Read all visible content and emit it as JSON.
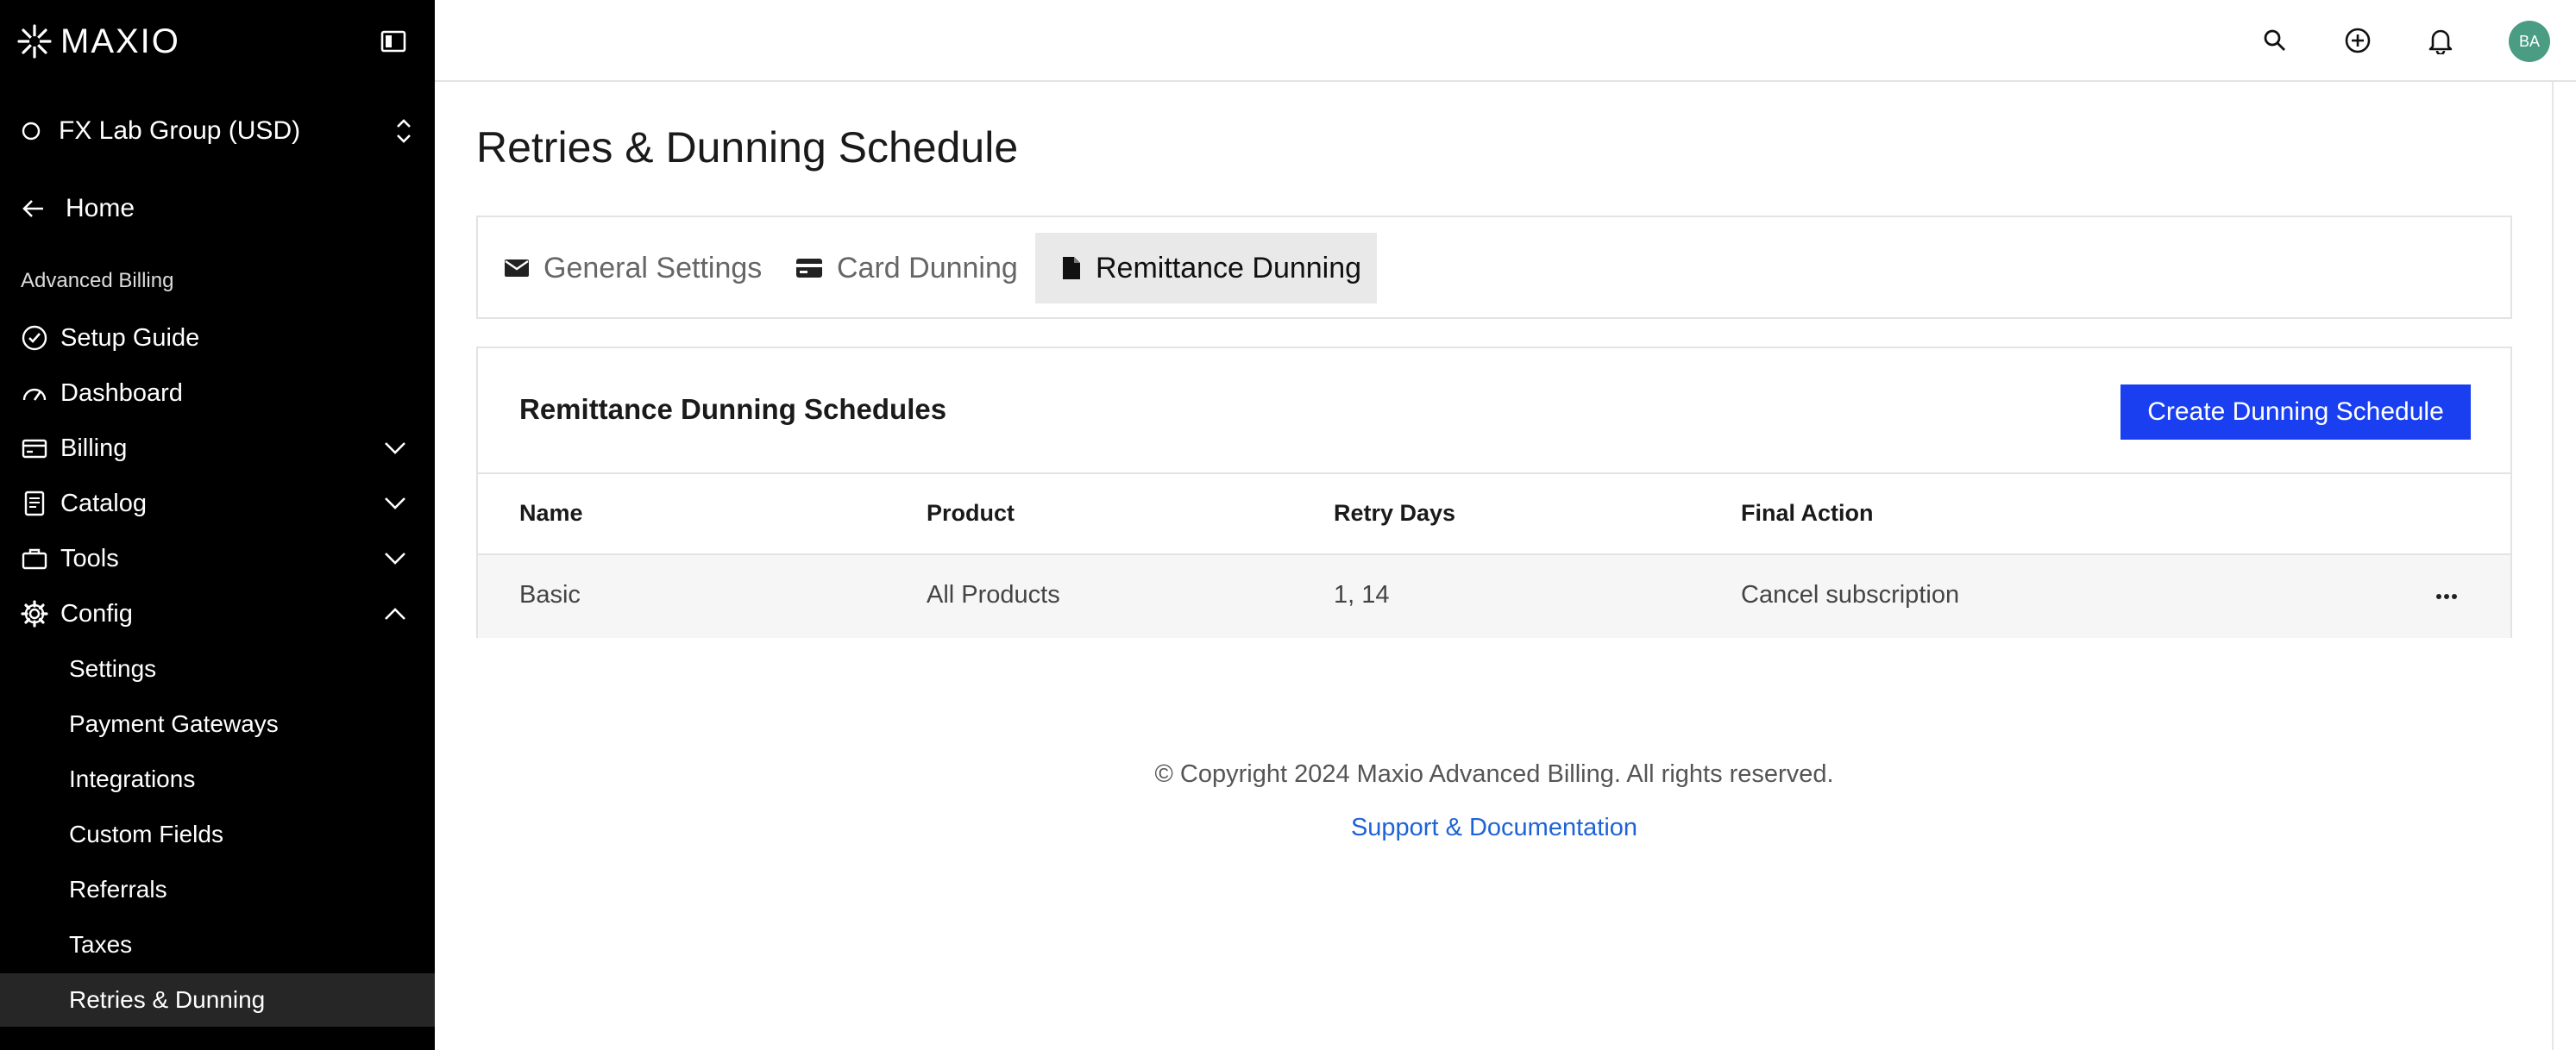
{
  "brand": {
    "name": "MAXIO"
  },
  "sidebar": {
    "org_name": "FX Lab Group (USD)",
    "home_label": "Home",
    "section_label": "Advanced Billing",
    "items": [
      {
        "label": "Setup Guide",
        "icon": "check-circle-icon"
      },
      {
        "label": "Dashboard",
        "icon": "gauge-icon"
      },
      {
        "label": "Billing",
        "icon": "card-icon"
      },
      {
        "label": "Catalog",
        "icon": "document-icon"
      },
      {
        "label": "Tools",
        "icon": "briefcase-icon"
      },
      {
        "label": "Config",
        "icon": "gear-icon"
      }
    ],
    "config_sub": [
      {
        "label": "Settings"
      },
      {
        "label": "Payment Gateways"
      },
      {
        "label": "Integrations"
      },
      {
        "label": "Custom Fields"
      },
      {
        "label": "Referrals"
      },
      {
        "label": "Taxes"
      },
      {
        "label": "Retries & Dunning"
      }
    ],
    "active_sub": "Retries & Dunning"
  },
  "topbar": {
    "avatar_initials": "BA",
    "avatar_color": "#4a9d82"
  },
  "page": {
    "title": "Retries & Dunning Schedule"
  },
  "tabs": [
    {
      "label": "General Settings",
      "icon": "envelope-icon"
    },
    {
      "label": "Card Dunning",
      "icon": "credit-card-icon"
    },
    {
      "label": "Remittance Dunning",
      "icon": "file-icon",
      "active": true
    }
  ],
  "schedules": {
    "title": "Remittance Dunning Schedules",
    "create_button": "Create Dunning Schedule",
    "columns": [
      "Name",
      "Product",
      "Retry Days",
      "Final Action"
    ],
    "rows": [
      {
        "name": "Basic",
        "product": "All Products",
        "retry_days": "1, 14",
        "final_action": "Cancel subscription"
      }
    ]
  },
  "footer": {
    "copyright": "© Copyright 2024 Maxio Advanced Billing. All rights reserved.",
    "link": "Support & Documentation"
  },
  "colors": {
    "primary_button": "#1a3ff0",
    "link": "#1e63d6",
    "sidebar_bg": "#000000"
  }
}
